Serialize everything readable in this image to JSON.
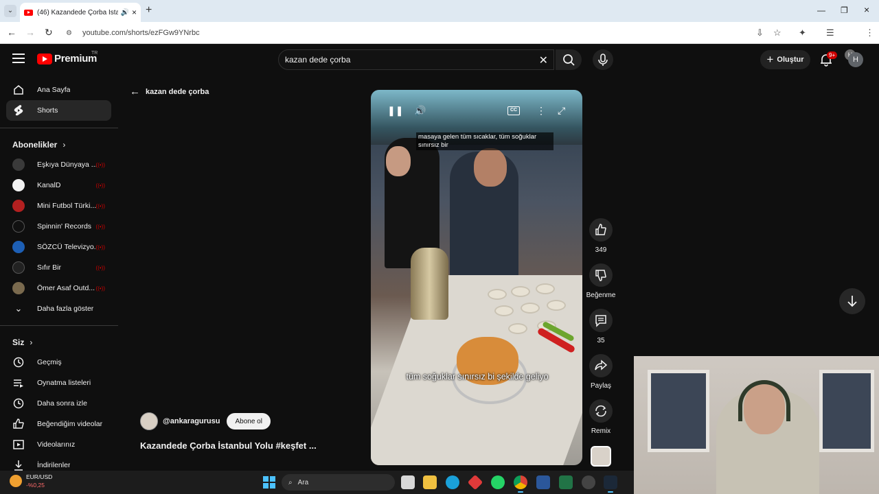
{
  "browser": {
    "tab_title": "(46) Kazandede Çorba İstan",
    "url": "youtube.com/shorts/ezFGw9YNrbc",
    "profile_initial": "H"
  },
  "header": {
    "logo_text": "Premium",
    "logo_region": "TR",
    "search_value": "kazan dede çorba",
    "create_label": "Oluştur",
    "notification_badge": "9+",
    "avatar_initial": "H"
  },
  "sidebar": {
    "main": [
      {
        "label": "Ana Sayfa",
        "icon": "home-icon"
      },
      {
        "label": "Shorts",
        "icon": "shorts-icon",
        "active": true
      }
    ],
    "subscriptions_title": "Abonelikler",
    "subscriptions": [
      {
        "label": "Eşkıya Dünyaya ...",
        "color": "#3a3a3a"
      },
      {
        "label": "KanalD",
        "color": "#f2f2f2"
      },
      {
        "label": "Mini Futbol Türki...",
        "color": "#b32020"
      },
      {
        "label": "Spinnin' Records",
        "color": "#111111"
      },
      {
        "label": "SÖZCÜ Televizyo...",
        "color": "#1d5fb5"
      },
      {
        "label": "Sıfır Bir",
        "color": "#222222"
      },
      {
        "label": "Ömer Asaf Outd...",
        "color": "#7a6a4e"
      }
    ],
    "show_more_label": "Daha fazla göster",
    "you_title": "Siz",
    "you_items": [
      {
        "label": "Geçmiş",
        "icon": "history-icon"
      },
      {
        "label": "Oynatma listeleri",
        "icon": "playlist-icon"
      },
      {
        "label": "Daha sonra izle",
        "icon": "clock-icon"
      },
      {
        "label": "Beğendiğim videolar",
        "icon": "thumbs-up-icon"
      },
      {
        "label": "Videolarınız",
        "icon": "video-icon"
      },
      {
        "label": "İndirilenler",
        "icon": "download-icon"
      }
    ]
  },
  "shorts": {
    "back_label": "kazan dede çorba",
    "subtitle_top": "masaya gelen tüm sıcaklar, tüm soğuklar sınırsız bir",
    "subtitle_bottom": "tüm soğuklar sınırsız bi şekilde geliyo",
    "cc_label": "CC",
    "actions": {
      "like_count": "349",
      "dislike_label": "Beğenme",
      "comment_count": "35",
      "share_label": "Paylaş",
      "remix_label": "Remix"
    },
    "channel_name": "@ankaragurusu",
    "subscribe_label": "Abone ol",
    "video_title": "Kazandede Çorba İstanbul Yolu #keşfet ..."
  },
  "taskbar": {
    "weather_title": "EUR/USD",
    "weather_value": "-%0,25",
    "search_placeholder": "Ara"
  }
}
